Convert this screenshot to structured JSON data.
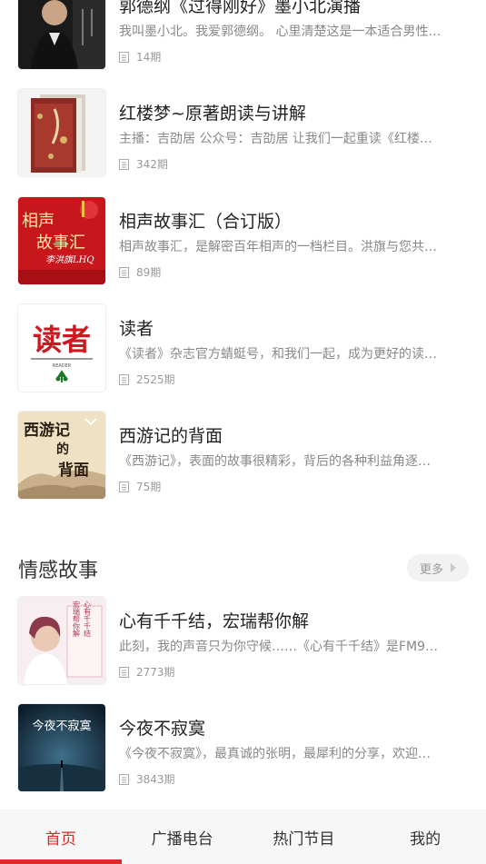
{
  "list_top": [
    {
      "title": "郭德纲《过得刚好》墨小北演播",
      "desc": "我叫墨小北。我爱郭德纲。 心里清楚这是一本适合男性…",
      "count": "14期",
      "cover": "guo-degang-book-cover"
    },
    {
      "title": "红楼梦~原著朗读与讲解",
      "desc": "主播：吉劭居 公众号：吉劭居 让我们一起重读《红楼…",
      "count": "342期",
      "cover": "hongloumeng-book-cover"
    },
    {
      "title": "相声故事汇（合订版）",
      "desc": "相声故事汇，是解密百年相声的一档栏目。洪旗与您共…",
      "count": "89期",
      "cover": "xiangsheng-cover",
      "cover_text": "相声",
      "cover_text2": "故事汇",
      "cover_sig": "李洪旗LHQ"
    },
    {
      "title": "读者",
      "desc": "《读者》杂志官方蜻蜓号，和我们一起，成为更好的读…",
      "count": "2525期",
      "cover": "duzhe-magazine-logo",
      "cover_text": "读者",
      "cover_sub": "READER"
    },
    {
      "title": "西游记的背面",
      "desc": "《西游记》，表面的故事很精彩，背后的各种利益角逐…",
      "count": "75期",
      "cover": "xiyouji-cover",
      "cover_text": "西游记",
      "cover_text2": "的",
      "cover_text3": "背面"
    }
  ],
  "section": {
    "title": "情感故事",
    "more_label": "更多"
  },
  "list_bottom": [
    {
      "title": "心有千千结，宏瑞帮你解",
      "desc": "此刻，我的声音只为你守候……《心有千千结》是FM9…",
      "count": "2773期",
      "cover": "xinyou-cover",
      "cover_text": "心有千千结",
      "cover_text2": "宏瑞帮你解"
    },
    {
      "title": "今夜不寂寞",
      "desc": "《今夜不寂寞》，最真诚的张明，最犀利的分享，欢迎…",
      "count": "3843期",
      "cover": "jinye-cover",
      "cover_text": "今夜不寂寞"
    }
  ],
  "tabs": [
    {
      "label": "首页",
      "active": true
    },
    {
      "label": "广播电台",
      "active": false
    },
    {
      "label": "热门节目",
      "active": false
    },
    {
      "label": "我的",
      "active": false
    }
  ],
  "colors": {
    "accent": "#d92b2b",
    "tabbar_bg": "#f7f7f7"
  }
}
